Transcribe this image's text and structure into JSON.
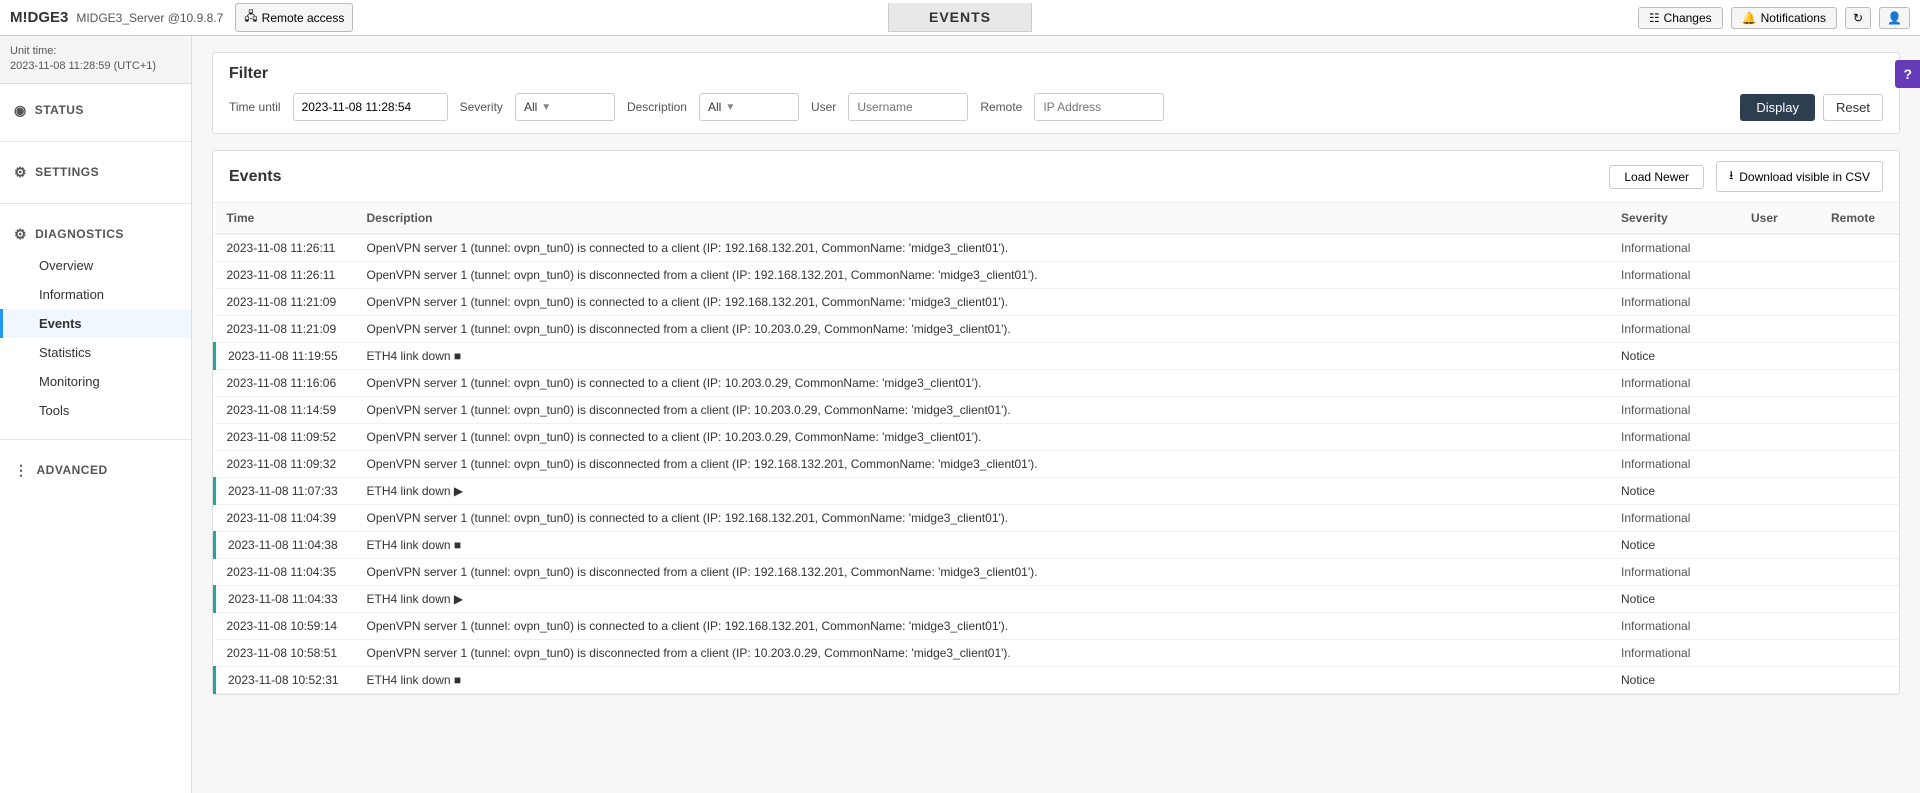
{
  "header": {
    "logo": "M!DGE3",
    "device": "MIDGE3_Server @10.9.8.7",
    "remote_access_label": "Remote access",
    "page_title": "EVENTS",
    "changes_label": "Changes",
    "notifications_label": "Notifications"
  },
  "sidebar": {
    "unit_time_label": "Unit time:",
    "unit_time_value": "2023-11-08 11:28:59 (UTC+1)",
    "sections": [
      {
        "id": "status",
        "label": "STATUS",
        "icon": "⊙",
        "items": []
      },
      {
        "id": "settings",
        "label": "SETTINGS",
        "icon": "⚙",
        "items": []
      },
      {
        "id": "diagnostics",
        "label": "DIAGNOSTICS",
        "icon": "🔧",
        "items": [
          {
            "id": "overview",
            "label": "Overview",
            "active": false
          },
          {
            "id": "information",
            "label": "Information",
            "active": false
          },
          {
            "id": "events",
            "label": "Events",
            "active": true
          },
          {
            "id": "statistics",
            "label": "Statistics",
            "active": false
          },
          {
            "id": "monitoring",
            "label": "Monitoring",
            "active": false
          },
          {
            "id": "tools",
            "label": "Tools",
            "active": false
          }
        ]
      },
      {
        "id": "advanced",
        "label": "ADVANCED",
        "icon": "⊞",
        "items": []
      }
    ]
  },
  "filter": {
    "title": "Filter",
    "time_until_label": "Time until",
    "time_until_value": "2023-11-08 11:28:54",
    "severity_label": "Severity",
    "severity_value": "All",
    "description_label": "Description",
    "description_value": "All",
    "user_label": "User",
    "user_placeholder": "Username",
    "remote_label": "Remote",
    "remote_placeholder": "IP Address",
    "display_label": "Display",
    "reset_label": "Reset"
  },
  "events": {
    "title": "Events",
    "load_newer_label": "Load Newer",
    "download_label": "Download visible in CSV",
    "columns": {
      "time": "Time",
      "description": "Description",
      "severity": "Severity",
      "user": "User",
      "remote": "Remote"
    },
    "rows": [
      {
        "time": "2023-11-08 11:26:11",
        "description": "OpenVPN server 1 (tunnel: ovpn_tun0) is connected to a client (IP: 192.168.132.201, CommonName: 'midge3_client01').",
        "severity": "Informational",
        "user": "",
        "remote": "",
        "eth_link": false
      },
      {
        "time": "2023-11-08 11:26:11",
        "description": "OpenVPN server 1 (tunnel: ovpn_tun0) is disconnected from a client (IP: 192.168.132.201, CommonName: 'midge3_client01').",
        "severity": "Informational",
        "user": "",
        "remote": "",
        "eth_link": false
      },
      {
        "time": "2023-11-08 11:21:09",
        "description": "OpenVPN server 1 (tunnel: ovpn_tun0) is connected to a client (IP: 192.168.132.201, CommonName: 'midge3_client01').",
        "severity": "Informational",
        "user": "",
        "remote": "",
        "eth_link": false
      },
      {
        "time": "2023-11-08 11:21:09",
        "description": "OpenVPN server 1 (tunnel: ovpn_tun0) is disconnected from a client (IP: 10.203.0.29, CommonName: 'midge3_client01').",
        "severity": "Informational",
        "user": "",
        "remote": "",
        "eth_link": false
      },
      {
        "time": "2023-11-08 11:19:55",
        "description": "ETH4 link down ■",
        "severity": "Notice",
        "user": "",
        "remote": "",
        "eth_link": true
      },
      {
        "time": "2023-11-08 11:16:06",
        "description": "OpenVPN server 1 (tunnel: ovpn_tun0) is connected to a client (IP: 10.203.0.29, CommonName: 'midge3_client01').",
        "severity": "Informational",
        "user": "",
        "remote": "",
        "eth_link": false
      },
      {
        "time": "2023-11-08 11:14:59",
        "description": "OpenVPN server 1 (tunnel: ovpn_tun0) is disconnected from a client (IP: 10.203.0.29, CommonName: 'midge3_client01').",
        "severity": "Informational",
        "user": "",
        "remote": "",
        "eth_link": false
      },
      {
        "time": "2023-11-08 11:09:52",
        "description": "OpenVPN server 1 (tunnel: ovpn_tun0) is connected to a client (IP: 10.203.0.29, CommonName: 'midge3_client01').",
        "severity": "Informational",
        "user": "",
        "remote": "",
        "eth_link": false
      },
      {
        "time": "2023-11-08 11:09:32",
        "description": "OpenVPN server 1 (tunnel: ovpn_tun0) is disconnected from a client (IP: 192.168.132.201, CommonName: 'midge3_client01').",
        "severity": "Informational",
        "user": "",
        "remote": "",
        "eth_link": false
      },
      {
        "time": "2023-11-08 11:07:33",
        "description": "ETH4 link down ▶",
        "severity": "Notice",
        "user": "",
        "remote": "",
        "eth_link": true
      },
      {
        "time": "2023-11-08 11:04:39",
        "description": "OpenVPN server 1 (tunnel: ovpn_tun0) is connected to a client (IP: 192.168.132.201, CommonName: 'midge3_client01').",
        "severity": "Informational",
        "user": "",
        "remote": "",
        "eth_link": false
      },
      {
        "time": "2023-11-08 11:04:38",
        "description": "ETH4 link down ■",
        "severity": "Notice",
        "user": "",
        "remote": "",
        "eth_link": true
      },
      {
        "time": "2023-11-08 11:04:35",
        "description": "OpenVPN server 1 (tunnel: ovpn_tun0) is disconnected from a client (IP: 192.168.132.201, CommonName: 'midge3_client01').",
        "severity": "Informational",
        "user": "",
        "remote": "",
        "eth_link": false
      },
      {
        "time": "2023-11-08 11:04:33",
        "description": "ETH4 link down ▶",
        "severity": "Notice",
        "user": "",
        "remote": "",
        "eth_link": true
      },
      {
        "time": "2023-11-08 10:59:14",
        "description": "OpenVPN server 1 (tunnel: ovpn_tun0) is connected to a client (IP: 192.168.132.201, CommonName: 'midge3_client01').",
        "severity": "Informational",
        "user": "",
        "remote": "",
        "eth_link": false
      },
      {
        "time": "2023-11-08 10:58:51",
        "description": "OpenVPN server 1 (tunnel: ovpn_tun0) is disconnected from a client (IP: 10.203.0.29, CommonName: 'midge3_client01').",
        "severity": "Informational",
        "user": "",
        "remote": "",
        "eth_link": false
      },
      {
        "time": "2023-11-08 10:52:31",
        "description": "ETH4 link down ■",
        "severity": "Notice",
        "user": "",
        "remote": "",
        "eth_link": true
      }
    ]
  },
  "help_btn": "?"
}
